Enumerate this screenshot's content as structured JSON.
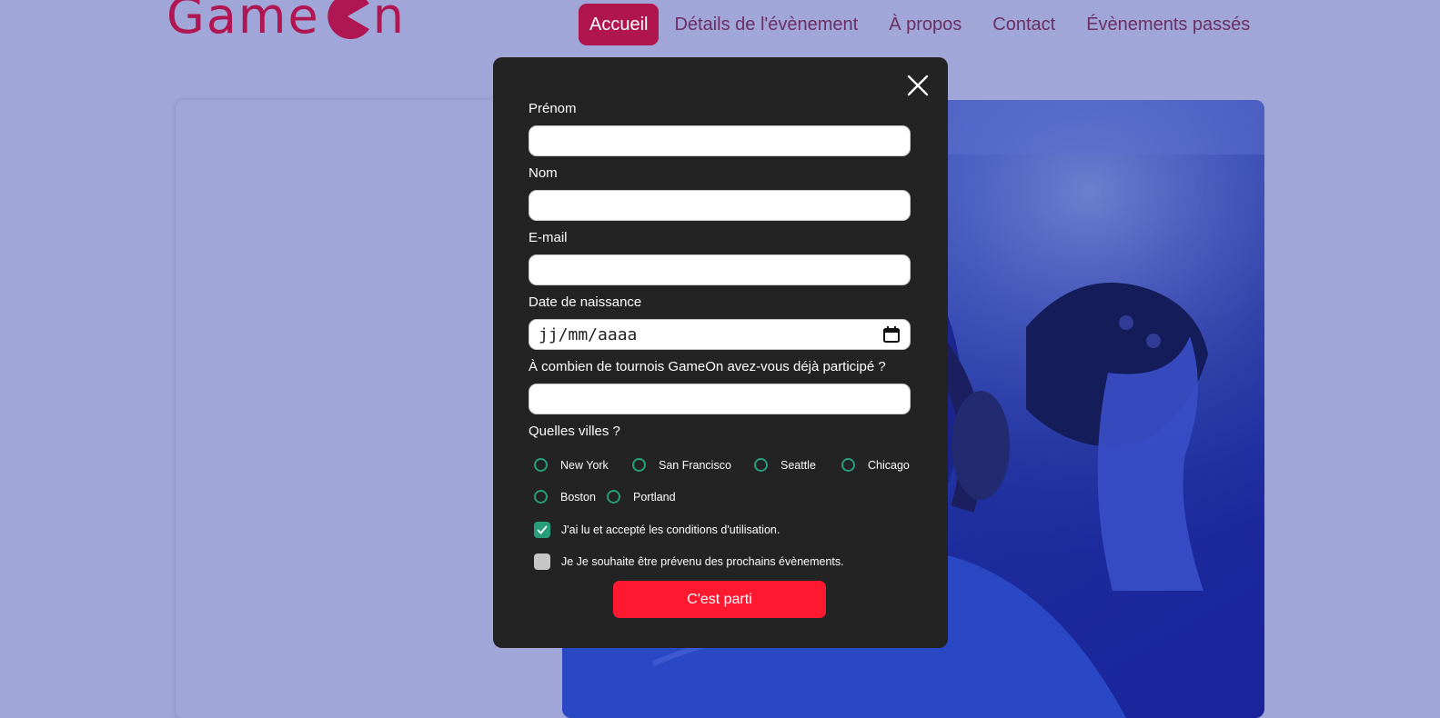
{
  "header": {
    "logo": {
      "text_left": "Game",
      "text_right": "n"
    },
    "nav": [
      {
        "label": "Accueil",
        "active": true
      },
      {
        "label": "Détails de l'évènement"
      },
      {
        "label": "À propos"
      },
      {
        "label": "Contact"
      },
      {
        "label": "Évènements passés"
      }
    ]
  },
  "modal": {
    "fields": {
      "first_name": {
        "label": "Prénom",
        "value": ""
      },
      "last_name": {
        "label": "Nom",
        "value": ""
      },
      "email": {
        "label": "E-mail",
        "value": ""
      },
      "birthdate": {
        "label": "Date de naissance",
        "placeholder": "jj/mm/aaaa"
      },
      "tournaments": {
        "label": "À combien de tournois GameOn avez-vous déjà participé ?",
        "value": ""
      }
    },
    "cities": {
      "label": "Quelles villes ?",
      "options": [
        "New York",
        "San Francisco",
        "Seattle",
        "Chicago",
        "Boston",
        "Portland"
      ]
    },
    "checkboxes": [
      {
        "label": "J'ai lu et accepté les conditions d'utilisation.",
        "checked": true
      },
      {
        "label": "Je Je souhaite être prévenu des prochains évènements.",
        "checked": false
      }
    ],
    "submit_label": "C'est parti"
  },
  "colors": {
    "page_bg": "#a1a6d8",
    "brand": "#b0154d",
    "modal_bg": "#232323",
    "accent_green": "#279e7a",
    "submit_red": "#fe1830"
  },
  "icons": {
    "close": "close-icon",
    "calendar": "calendar-icon",
    "check": "check-icon"
  }
}
